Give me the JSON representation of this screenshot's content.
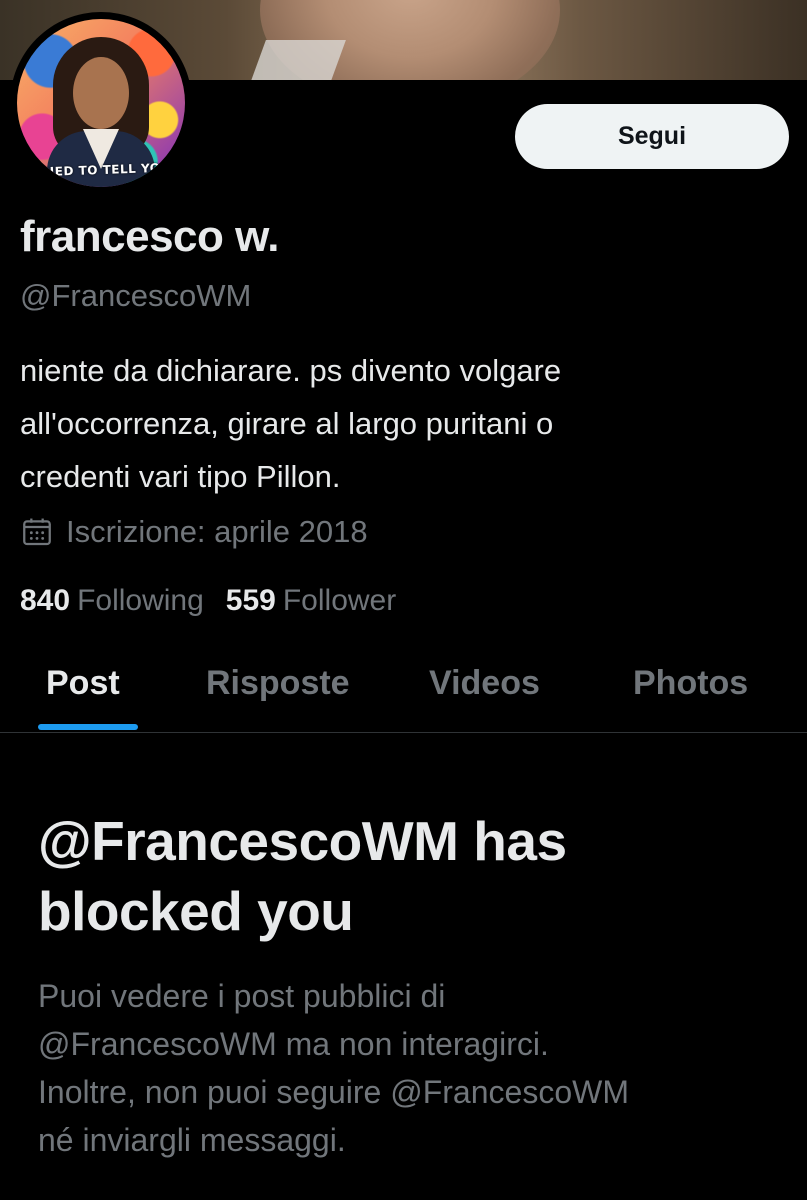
{
  "profile": {
    "avatar_caption": "TRIED TO TELL YOU",
    "follow_label": "Segui",
    "display_name": "francesco w.",
    "handle": "@FrancescoWM",
    "bio_lines": [
      "niente da dichiarare. ps divento volgare",
      "all'occorrenza, girare al largo puritani o",
      "credenti vari tipo Pillon."
    ],
    "joined": "Iscrizione: aprile 2018",
    "joined_icon": "calendar-icon",
    "following_count": "840",
    "following_label": "Following",
    "followers_count": "559",
    "followers_label": "Follower"
  },
  "tabs": {
    "items": [
      {
        "label": "Post",
        "active": true
      },
      {
        "label": "Risposte",
        "active": false
      },
      {
        "label": "Videos",
        "active": false
      },
      {
        "label": "Photos",
        "active": false
      }
    ]
  },
  "blocked": {
    "title_lines": [
      "@FrancescoWM has",
      "blocked you"
    ],
    "desc_lines": [
      "Puoi vedere i post pubblici di",
      "@FrancescoWM ma non interagirci.",
      "Inoltre, non puoi seguire @FrancescoWM",
      "né inviargli messaggi."
    ]
  },
  "colors": {
    "background": "#000000",
    "text_primary": "#e7e9ea",
    "text_secondary": "#71767b",
    "accent": "#1d9bf0",
    "button_bg": "#eff3f4"
  }
}
